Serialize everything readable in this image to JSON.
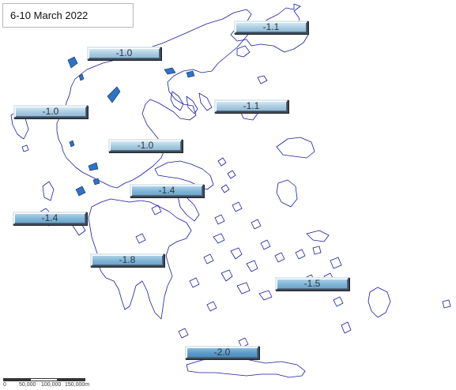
{
  "title": "6-10 March 2022",
  "labels": [
    {
      "id": "northeast",
      "value": "-1.1",
      "shade": "light"
    },
    {
      "id": "northwest",
      "value": "-1.0",
      "shade": "light"
    },
    {
      "id": "west",
      "value": "-1.0",
      "shade": "light"
    },
    {
      "id": "north-central",
      "value": "-1.1",
      "shade": "light"
    },
    {
      "id": "central",
      "value": "-1.0",
      "shade": "light"
    },
    {
      "id": "east-central",
      "value": "-1.4",
      "shade": "medium"
    },
    {
      "id": "southwest",
      "value": "-1.4",
      "shade": "medium"
    },
    {
      "id": "peloponnese",
      "value": "-1.8",
      "shade": "medium"
    },
    {
      "id": "southeast",
      "value": "-1.5",
      "shade": "medium"
    },
    {
      "id": "south",
      "value": "-2.0",
      "shade": "dark"
    }
  ],
  "scale": {
    "labels": [
      "0",
      "50,000",
      "100,000",
      "150,000m"
    ]
  },
  "colors": {
    "coastline": "#1a1aa6",
    "water_body": "#2d73c7"
  }
}
